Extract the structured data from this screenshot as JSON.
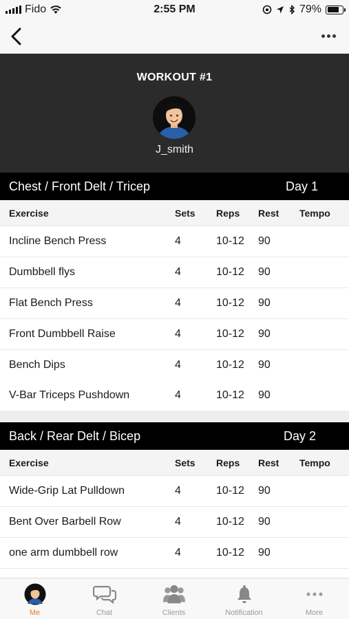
{
  "status": {
    "carrier": "Fido",
    "time": "2:55 PM",
    "battery": "79%",
    "battery_level": 0.79
  },
  "header": {
    "title": "WORKOUT #1",
    "username": "J_smith"
  },
  "columns": {
    "exercise": "Exercise",
    "sets": "Sets",
    "reps": "Reps",
    "rest": "Rest",
    "tempo": "Tempo"
  },
  "days": [
    {
      "name": "Chest / Front Delt / Tricep",
      "day": "Day 1",
      "exercises": [
        {
          "name": "Incline Bench Press",
          "sets": "4",
          "reps": "10-12",
          "rest": "90",
          "tempo": ""
        },
        {
          "name": "Dumbbell flys",
          "sets": "4",
          "reps": "10-12",
          "rest": "90",
          "tempo": ""
        },
        {
          "name": "Flat Bench Press",
          "sets": "4",
          "reps": "10-12",
          "rest": "90",
          "tempo": ""
        },
        {
          "name": "Front Dumbbell Raise",
          "sets": "4",
          "reps": "10-12",
          "rest": "90",
          "tempo": ""
        },
        {
          "name": "Bench Dips",
          "sets": "4",
          "reps": "10-12",
          "rest": "90",
          "tempo": ""
        },
        {
          "name": "V-Bar Triceps Pushdown",
          "sets": "4",
          "reps": "10-12",
          "rest": "90",
          "tempo": ""
        }
      ]
    },
    {
      "name": "Back / Rear Delt / Bicep",
      "day": "Day 2",
      "exercises": [
        {
          "name": "Wide-Grip Lat Pulldown",
          "sets": "4",
          "reps": "10-12",
          "rest": "90",
          "tempo": ""
        },
        {
          "name": "Bent Over Barbell Row",
          "sets": "4",
          "reps": "10-12",
          "rest": "90",
          "tempo": ""
        },
        {
          "name": "one arm dumbbell row",
          "sets": "4",
          "reps": "10-12",
          "rest": "90",
          "tempo": ""
        }
      ]
    }
  ],
  "tabs": [
    {
      "label": "Me",
      "icon": "avatar-icon",
      "active": true
    },
    {
      "label": "Chat",
      "icon": "chat-icon",
      "active": false
    },
    {
      "label": "Clients",
      "icon": "clients-icon",
      "active": false
    },
    {
      "label": "Notification",
      "icon": "bell-icon",
      "active": false
    },
    {
      "label": "More",
      "icon": "more-dots-icon",
      "active": false
    }
  ],
  "colors": {
    "header_bg": "#2b2b2b",
    "section_bg": "#000000",
    "accent": "#e8822d",
    "tab_inactive": "#9a9a9a"
  }
}
